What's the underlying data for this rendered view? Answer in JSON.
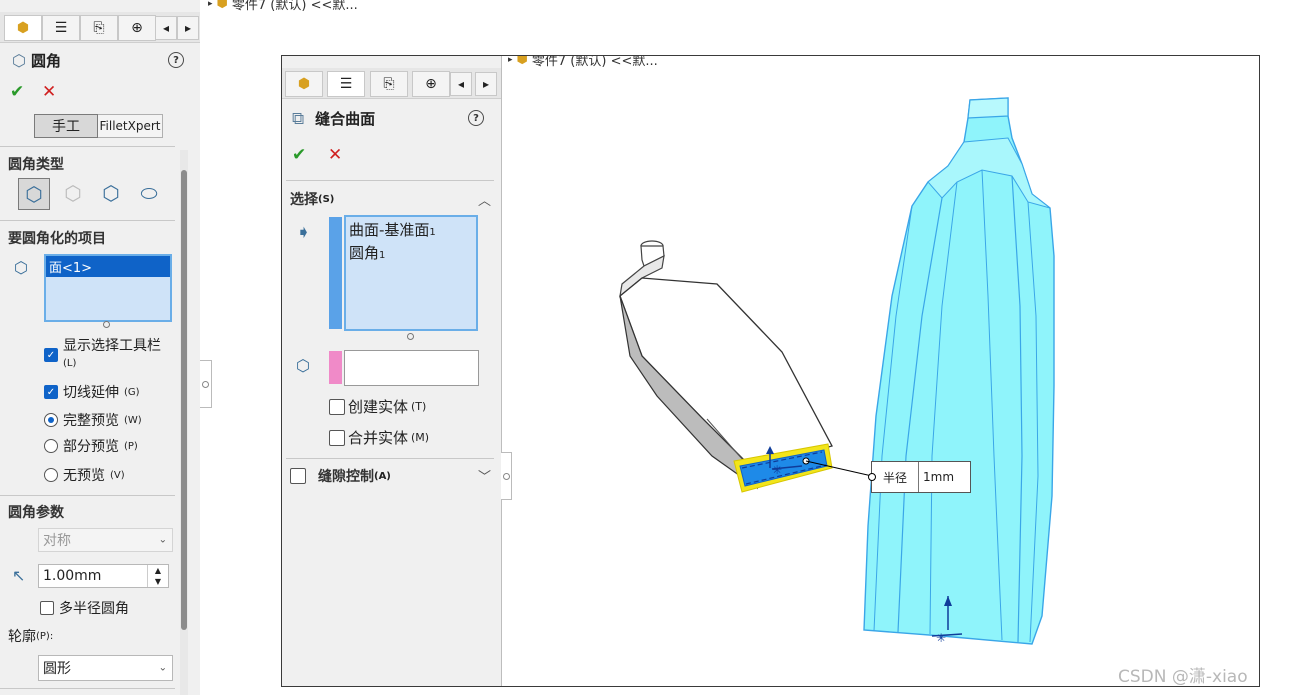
{
  "top_tree_label": "零件7 (默认) <<默...",
  "left_panel": {
    "title": "圆角",
    "help_icon": "?",
    "modes": [
      "手工",
      "FilletXpert"
    ],
    "fillet_type_heading": "圆角类型",
    "items_heading": "要圆角化的项目",
    "items": [
      "面<1>"
    ],
    "options": [
      {
        "label": "显示选择工具栏",
        "hotkey": "(L)",
        "checked": true,
        "type": "check"
      },
      {
        "label": "切线延伸",
        "hotkey": "(G)",
        "checked": true,
        "type": "check"
      },
      {
        "label": "完整预览",
        "hotkey": "(W)",
        "checked": true,
        "type": "radio"
      },
      {
        "label": "部分预览",
        "hotkey": "(P)",
        "checked": false,
        "type": "radio"
      },
      {
        "label": "无预览",
        "hotkey": "(V)",
        "checked": false,
        "type": "radio"
      }
    ],
    "params_heading": "圆角参数",
    "symmetric": "对称",
    "radius_value": "1.00mm",
    "multi_radius": "多半径圆角",
    "profile_label": "轮廓",
    "profile_hotkey": "(P):",
    "profile_value": "圆形"
  },
  "inner_window": {
    "tree_label": "零件7 (默认) <<默...",
    "panel_title": "缝合曲面",
    "help_icon": "?",
    "selection_heading": "选择",
    "selection_hotkey": "(S)",
    "selections": [
      {
        "label": "曲面-基准面",
        "sub": "1"
      },
      {
        "label": "圆角",
        "sub": "1"
      }
    ],
    "create_solid": "创建实体",
    "create_solid_hotkey": "(T)",
    "merge_solid": "合并实体",
    "merge_solid_hotkey": "(M)",
    "gap_control": "缝隙控制",
    "gap_control_hotkey": "(A)",
    "radius_callout_label": "半径",
    "radius_callout_value": "1mm"
  },
  "watermark": "CSDN @潇-xiao",
  "colors": {
    "accent_blue": "#0f63c8",
    "selection_bg": "#cfe3f8",
    "bottle_cyan": "#8ff4fb",
    "highlight_yellow": "#f2e51b",
    "pink_bar": "#f08ac8"
  }
}
